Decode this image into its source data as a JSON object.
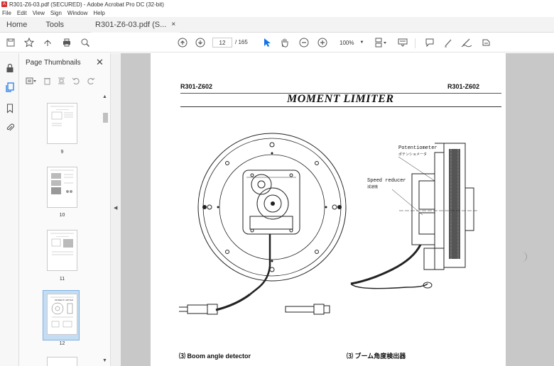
{
  "window": {
    "title": "R301-Z6-03.pdf (SECURED) - Adobe Acrobat Pro DC (32-bit)",
    "badge": "A"
  },
  "menu": [
    "File",
    "Edit",
    "View",
    "Sign",
    "Window",
    "Help"
  ],
  "tabs": {
    "home": "Home",
    "tools": "Tools",
    "doc": "R301-Z6-03.pdf (S...",
    "close": "×"
  },
  "toolbar": {
    "page_current": "12",
    "page_total": "/ 165",
    "zoom": "100%"
  },
  "panel": {
    "title": "Page Thumbnails",
    "close": "✕",
    "thumbs": [
      {
        "label": "9"
      },
      {
        "label": "10"
      },
      {
        "label": "11"
      },
      {
        "label": "12",
        "selected": true
      }
    ]
  },
  "document": {
    "header_left": "R301-Z602",
    "header_right": "R301-Z602",
    "title": "MOMENT  LIMITER",
    "label_potentiometer": "Potentiometer",
    "label_potentiometer_jp": "ポテンショメータ",
    "label_speed_reducer": "Speed reducer",
    "label_speed_reducer_jp": "減速機",
    "caption_left": "⑶   Boom  angle  detector",
    "caption_right": "⑶  ブーム角度検出器"
  },
  "colors": {
    "accent": "#1473e6",
    "selection": "#c5ddf3",
    "doc_bg": "#c8c8c8"
  }
}
